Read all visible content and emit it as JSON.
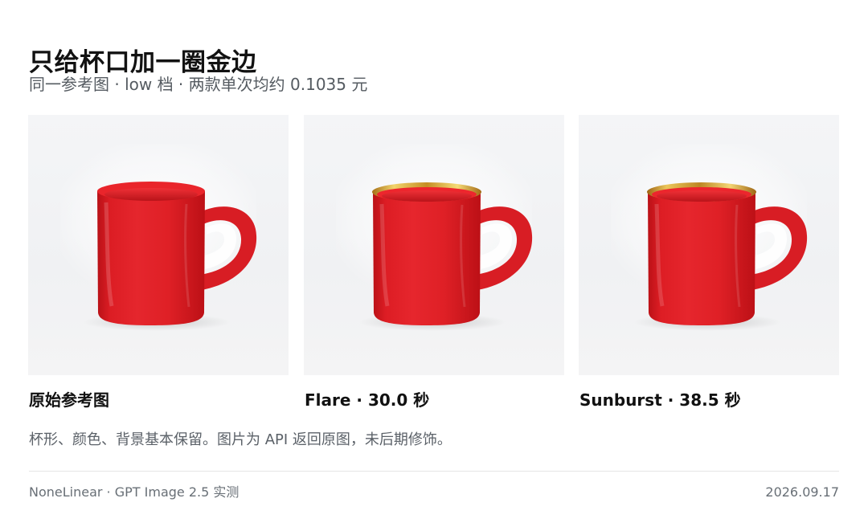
{
  "page": {
    "title": "只给杯口加一圈金边",
    "subtitle": "同一参考图 · low 档 · 两款单次均约 0.1035 元",
    "description": "杯形、颜色、背景基本保留。图片为 API 返回原图，未后期修饰。",
    "footer": {
      "left": "NoneLinear · GPT Image 2.5 实测",
      "right": "2026.09.17"
    }
  },
  "colors": {
    "background": "#ffffff",
    "title": "#121212",
    "muted_text": "#555b61",
    "divider": "#e5e5e5",
    "mug_red": "#e1252b",
    "gold_rim": "#d9a72f"
  },
  "cards": [
    {
      "caption": "原始参考图",
      "image_name": "red-mug-original",
      "has_gold_rim": false
    },
    {
      "caption": "Flare · 30.0 秒",
      "image_name": "red-mug-gold-rim-flare",
      "has_gold_rim": true
    },
    {
      "caption": "Sunburst · 38.5 秒",
      "image_name": "red-mug-gold-rim-sunburst",
      "has_gold_rim": true
    }
  ]
}
